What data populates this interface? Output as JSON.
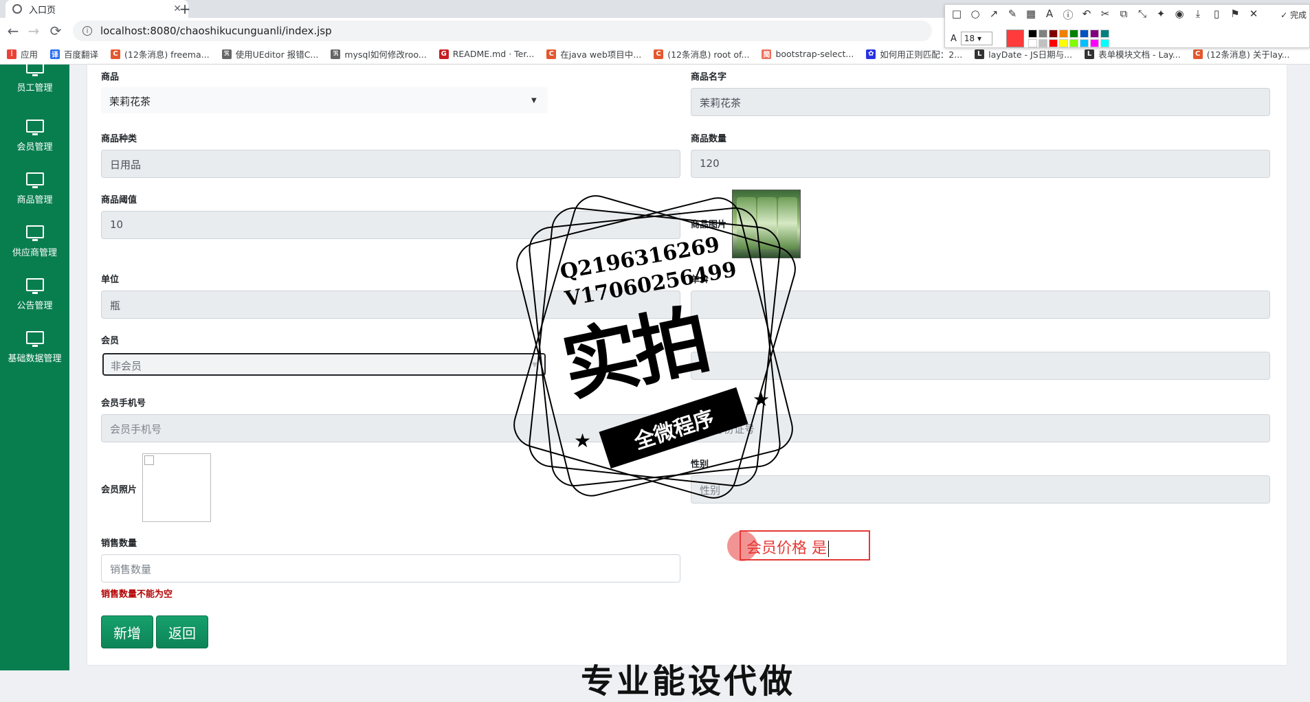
{
  "browser": {
    "tab_title": "入口页",
    "tab_close": "✕",
    "new_tab": "+",
    "url": "localhost:8080/chaoshikucunguanli/index.jsp",
    "back": "←",
    "forward": "→",
    "reload": "⟳",
    "key_icon": "⚿",
    "star_icon": "☆",
    "menu_icon": "⋮"
  },
  "bookmarks": [
    {
      "label": "应用",
      "icon_color": "#e94235",
      "glyph": "⋮"
    },
    {
      "label": "百度翻译",
      "icon_color": "#2a6ef0",
      "glyph": "译"
    },
    {
      "label": "(12条消息) freema...",
      "icon_color": "#e4572e",
      "glyph": "C"
    },
    {
      "label": "使用UEditor 报错C...",
      "icon_color": "#666666",
      "glyph": "ℜ"
    },
    {
      "label": "mysql如何修改roo...",
      "icon_color": "#666666",
      "glyph": "ℜ"
    },
    {
      "label": "README.md · Ter...",
      "icon_color": "#c71d23",
      "glyph": "G"
    },
    {
      "label": "在java web项目中...",
      "icon_color": "#e4572e",
      "glyph": "C"
    },
    {
      "label": "(12条消息) root of...",
      "icon_color": "#e4572e",
      "glyph": "C"
    },
    {
      "label": "bootstrap-select...",
      "icon_color": "#ea6f5a",
      "glyph": "简"
    },
    {
      "label": "如何用正则匹配：2...",
      "icon_color": "#2932e1",
      "glyph": "✿"
    },
    {
      "label": "layDate - JS日期与...",
      "icon_color": "#333333",
      "glyph": "L"
    },
    {
      "label": "表单模块文档 - Lay...",
      "icon_color": "#333333",
      "glyph": "L"
    },
    {
      "label": "(12条消息) 关于lay...",
      "icon_color": "#e4572e",
      "glyph": "C"
    }
  ],
  "snip_toolbar": {
    "tools": [
      "□",
      "○",
      "↗",
      "✎",
      "▦",
      "A",
      "ⓘ",
      "↶",
      "✂",
      "⧉",
      "⤡",
      "✦",
      "◉",
      "⤓",
      "▯",
      "⚑",
      "✕"
    ],
    "done_label": "✓ 完成",
    "font_glyph": "A",
    "font_size": "18",
    "current_color": "#ff3b3b",
    "swatches": [
      "#000000",
      "#808080",
      "#800000",
      "#f08000",
      "#008000",
      "#0050c0",
      "#800080",
      "#008080",
      "#ffffff",
      "#c0c0c0",
      "#ff0000",
      "#ffff00",
      "#80ff00",
      "#00c0ff",
      "#ff00ff",
      "#00ffff"
    ]
  },
  "sidebar": {
    "items": [
      {
        "label": "员工管理"
      },
      {
        "label": "会员管理"
      },
      {
        "label": "商品管理"
      },
      {
        "label": "供应商管理"
      },
      {
        "label": "公告管理"
      },
      {
        "label": "基础数据管理"
      }
    ]
  },
  "form": {
    "product_label": "商品",
    "product_value": "茉莉花茶",
    "product_name_label": "商品名字",
    "product_name_value": "茉莉花茶",
    "category_label": "商品种类",
    "category_value": "日用品",
    "quantity_label": "商品数量",
    "quantity_value": "120",
    "threshold_label": "商品阈值",
    "threshold_value": "10",
    "image_label": "商品图片",
    "unit_label": "单位",
    "unit_value": "瓶",
    "price_label": "单价",
    "member_label": "会员",
    "member_value": "非会员",
    "phone_label": "会员手机号",
    "phone_placeholder": "会员手机号",
    "idcard_placeholder": "身份证号",
    "photo_label": "会员照片",
    "gender_label": "性别",
    "gender_placeholder": "性别",
    "sales_label": "销售数量",
    "sales_placeholder": "销售数量",
    "sales_error": "销售数量不能为空",
    "add_button": "新增",
    "back_button": "返回"
  },
  "annotation": {
    "text": "会员价格 是"
  },
  "watermark": {
    "line1": "Q2196316269",
    "line2": "V17060256499",
    "big": "实拍",
    "ribbon": "全微程序",
    "star": "★",
    "bottom": "专业能设代做"
  }
}
